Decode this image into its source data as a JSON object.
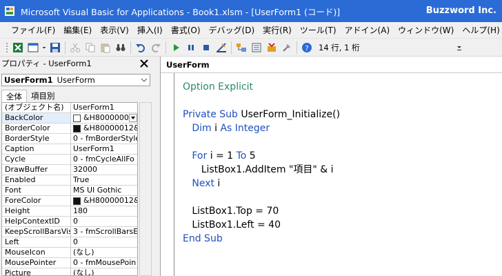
{
  "window": {
    "title": "Microsoft Visual Basic for Applications - Book1.xlsm - [UserForm1 (コード)]",
    "brand": "Buzzword Inc."
  },
  "menu": [
    "ファイル(F)",
    "編集(E)",
    "表示(V)",
    "挿入(I)",
    "書式(O)",
    "デバッグ(D)",
    "実行(R)",
    "ツール(T)",
    "アドイン(A)",
    "ウィンドウ(W)",
    "ヘルプ(H)"
  ],
  "toolbar": {
    "position": "14 行, 1 桁"
  },
  "properties": {
    "header": "プロパティ - UserForm1",
    "object_name": "UserForm1",
    "object_type": "UserForm",
    "tabs": [
      "全体",
      "項目別"
    ],
    "rows": [
      {
        "name": "(オブジェクト名)",
        "value": "UserForm1"
      },
      {
        "name": "BackColor",
        "value": "&H8000000",
        "swatch": "#ffffff",
        "dropdown": true
      },
      {
        "name": "BorderColor",
        "value": "&H80000012&",
        "swatch": "#111111"
      },
      {
        "name": "BorderStyle",
        "value": "0 - fmBorderStyle"
      },
      {
        "name": "Caption",
        "value": "UserForm1"
      },
      {
        "name": "Cycle",
        "value": "0 - fmCycleAllFo"
      },
      {
        "name": "DrawBuffer",
        "value": "32000"
      },
      {
        "name": "Enabled",
        "value": "True"
      },
      {
        "name": "Font",
        "value": "MS UI Gothic"
      },
      {
        "name": "ForeColor",
        "value": "&H80000012&",
        "swatch": "#111111"
      },
      {
        "name": "Height",
        "value": "180"
      },
      {
        "name": "HelpContextID",
        "value": "0"
      },
      {
        "name": "KeepScrollBarsVis",
        "value": "3 - fmScrollBarsE"
      },
      {
        "name": "Left",
        "value": "0"
      },
      {
        "name": "MouseIcon",
        "value": "(なし)"
      },
      {
        "name": "MousePointer",
        "value": "0 - fmMousePoin"
      },
      {
        "name": "Picture",
        "value": "(なし)"
      }
    ]
  },
  "code": {
    "object": "UserForm",
    "lines": [
      [
        {
          "t": "Option Explicit",
          "c": "cm"
        }
      ],
      [],
      [
        {
          "t": "Private Sub ",
          "c": "kw"
        },
        {
          "t": "UserForm_Initialize()",
          "c": "txt"
        }
      ],
      [
        {
          "t": "   Dim ",
          "c": "kw"
        },
        {
          "t": "i ",
          "c": "txt"
        },
        {
          "t": "As Integer",
          "c": "kw"
        }
      ],
      [],
      [
        {
          "t": "   For ",
          "c": "kw"
        },
        {
          "t": "i = 1 ",
          "c": "txt"
        },
        {
          "t": "To ",
          "c": "kw"
        },
        {
          "t": "5",
          "c": "txt"
        }
      ],
      [
        {
          "t": "      ListBox1.AddItem \"項目\" & i",
          "c": "txt"
        }
      ],
      [
        {
          "t": "   Next ",
          "c": "kw"
        },
        {
          "t": "i",
          "c": "txt"
        }
      ],
      [],
      [
        {
          "t": "   ListBox1.Top = 70",
          "c": "txt"
        }
      ],
      [
        {
          "t": "   ListBox1.Left = 40",
          "c": "txt"
        }
      ],
      [
        {
          "t": "End Sub",
          "c": "kw"
        }
      ]
    ]
  },
  "colors": {
    "titlebar": "#2b6bd6",
    "keyword": "#1f4fbd",
    "comment": "#2a8a6a"
  }
}
